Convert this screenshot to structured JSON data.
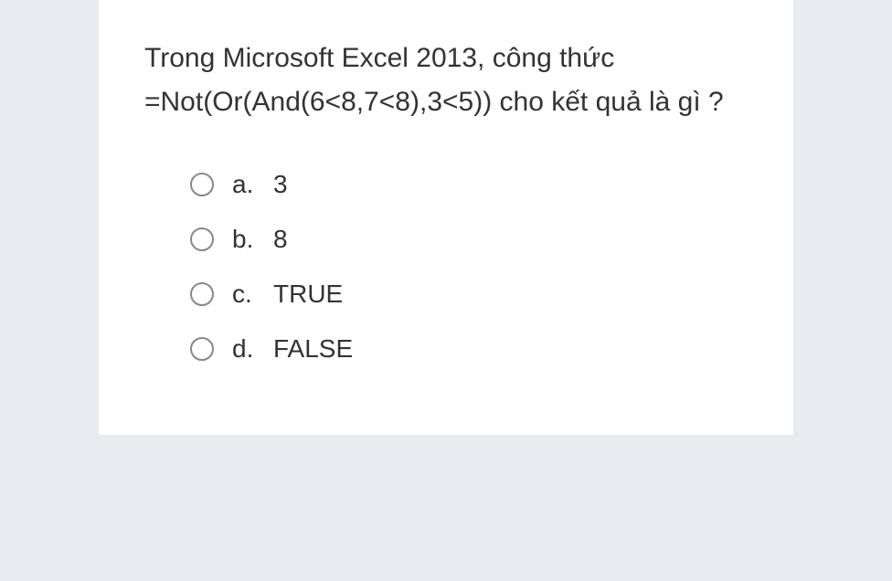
{
  "question": {
    "text": "Trong Microsoft Excel 2013, công thức =Not(Or(And(6<8,7<8),3<5)) cho kết quả là gì ?"
  },
  "options": [
    {
      "letter": "a.",
      "value": "3"
    },
    {
      "letter": "b.",
      "value": "8"
    },
    {
      "letter": "c.",
      "value": "TRUE"
    },
    {
      "letter": "d.",
      "value": "FALSE"
    }
  ]
}
